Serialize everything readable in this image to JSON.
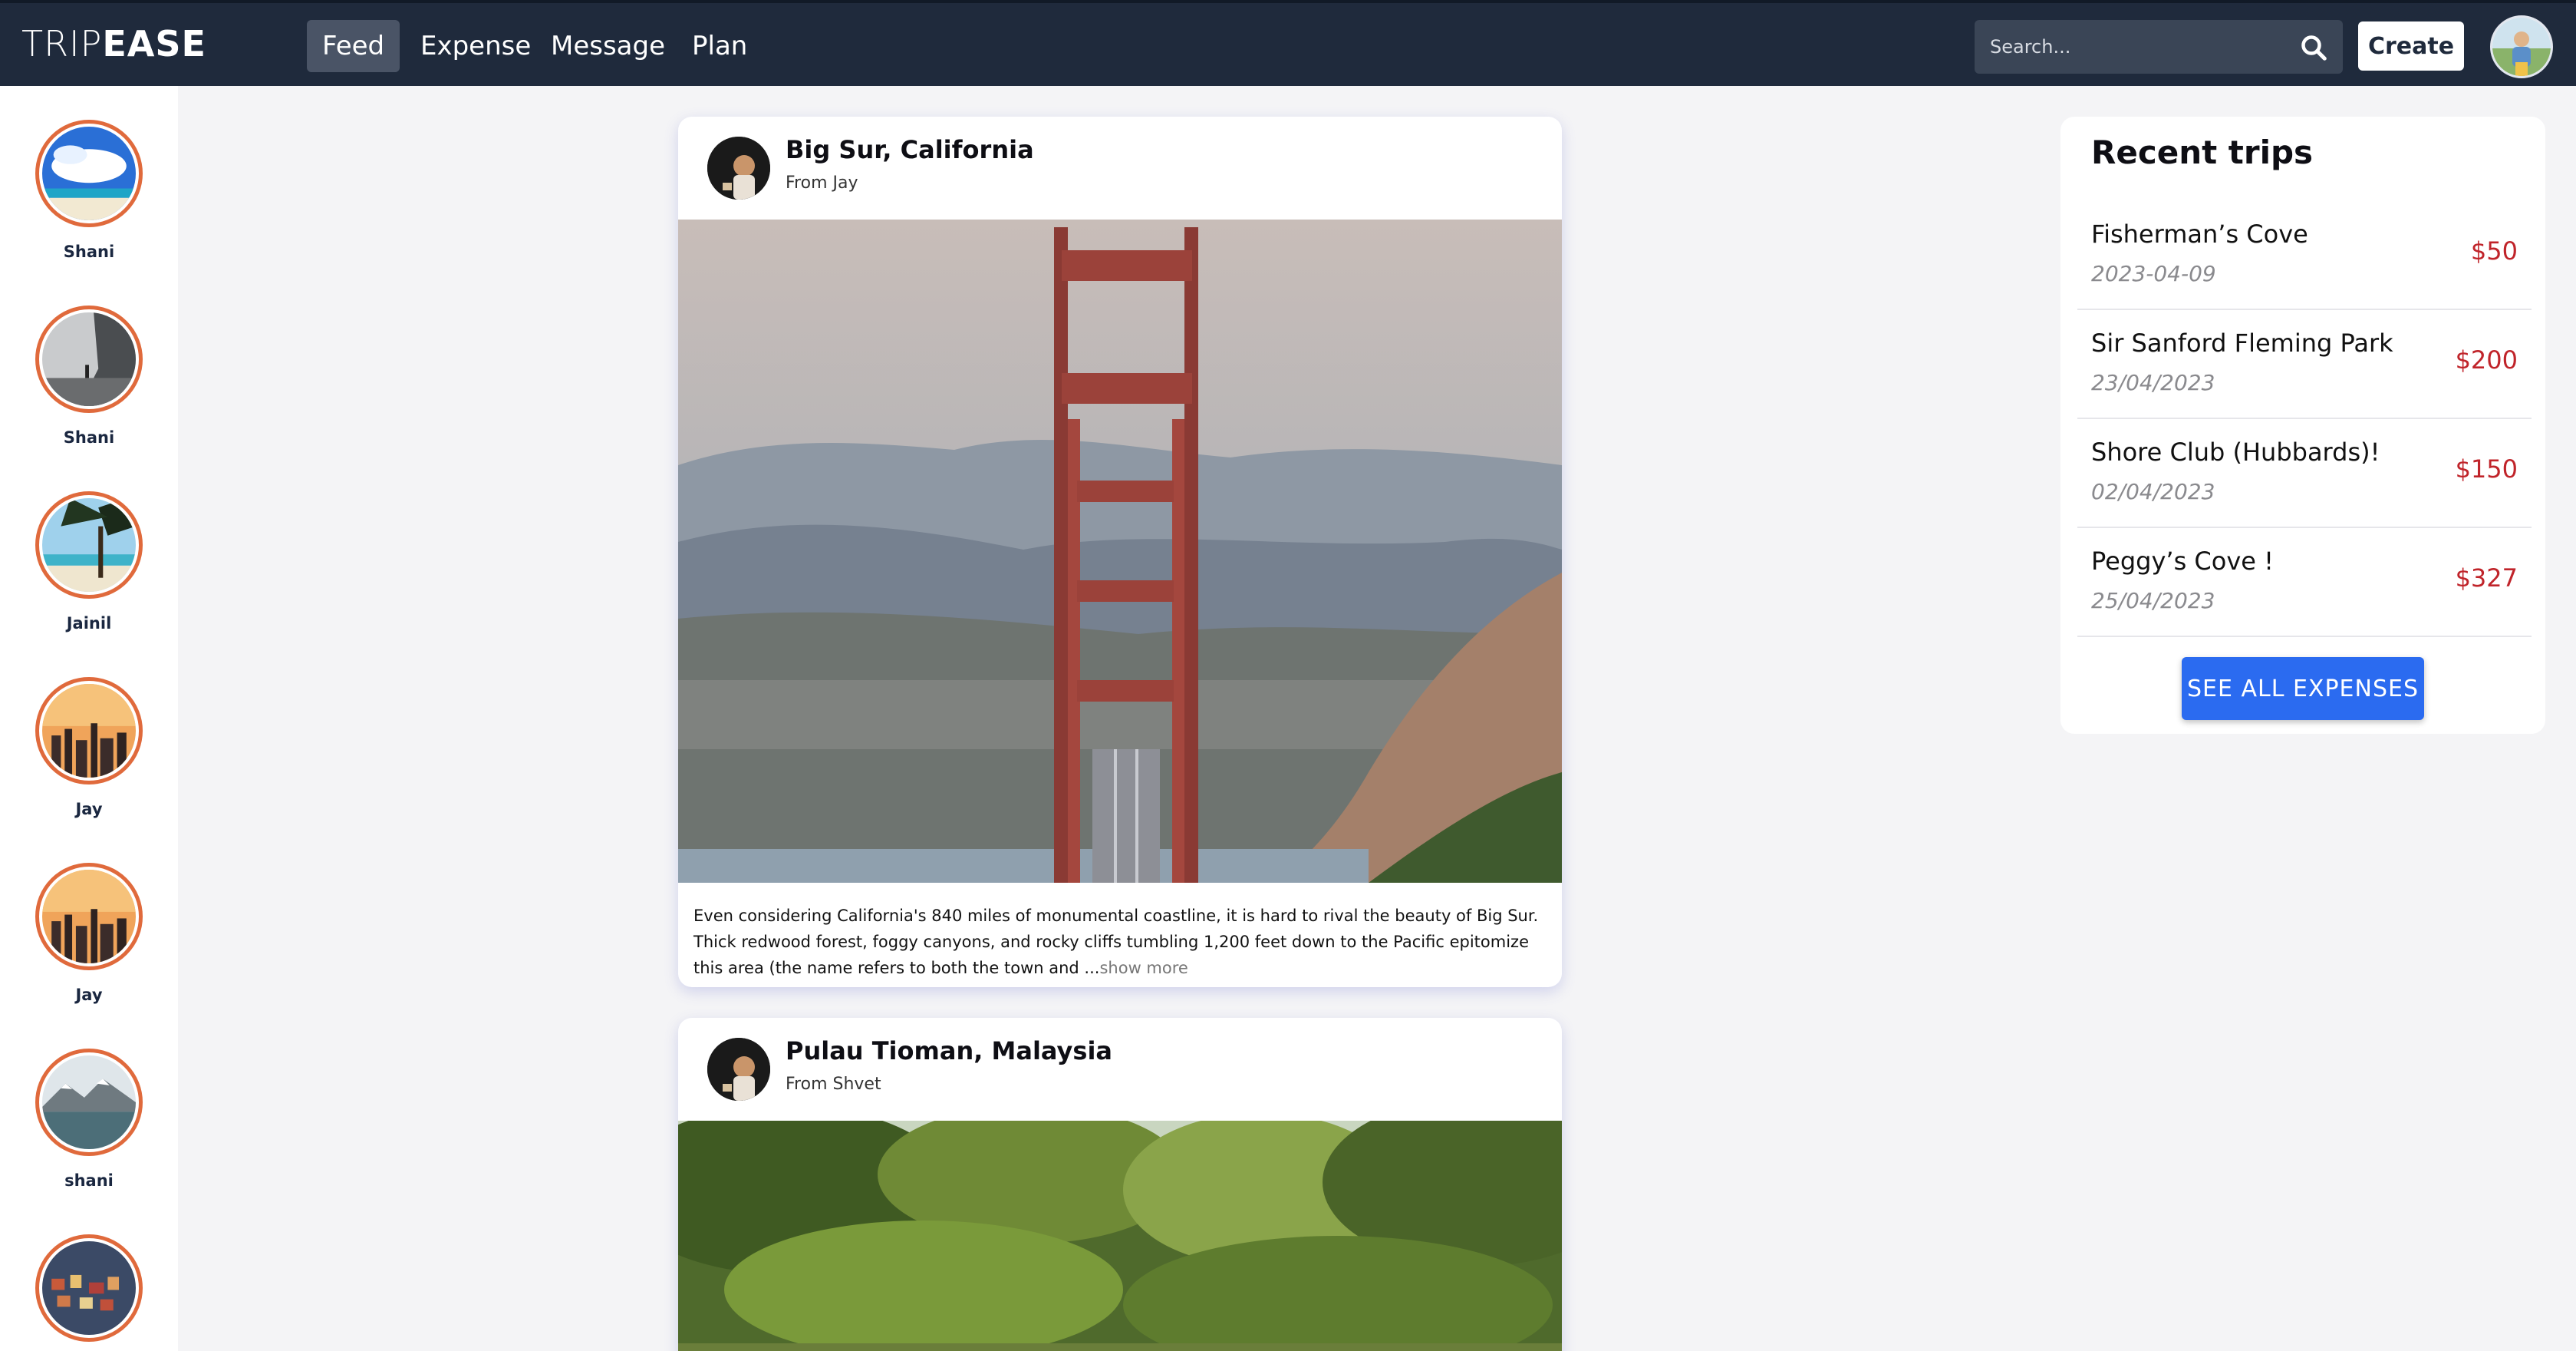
{
  "app": {
    "logo_light": "TRIP",
    "logo_bold": "EASE"
  },
  "nav": {
    "tabs": [
      {
        "label": "Feed",
        "active": true
      },
      {
        "label": "Expense",
        "active": false
      },
      {
        "label": "Message",
        "active": false
      },
      {
        "label": "Plan",
        "active": false
      }
    ],
    "search_placeholder": "Search...",
    "create_label": "Create"
  },
  "stories": [
    {
      "name": "Shani",
      "image": "beach-sky"
    },
    {
      "name": "Shani",
      "image": "misty-cliff"
    },
    {
      "name": "Jainil",
      "image": "palm-beach"
    },
    {
      "name": "Jay",
      "image": "city-sunset"
    },
    {
      "name": "Jay",
      "image": "city-sunset"
    },
    {
      "name": "shani",
      "image": "glacier-lake"
    },
    {
      "name": "",
      "image": "coastal-town"
    }
  ],
  "posts": [
    {
      "title": "Big Sur, California",
      "from": "From Jay",
      "image": "golden-gate-bridge",
      "caption": "Even considering California's 840 miles of monumental coastline, it is hard to rival the beauty of Big Sur. Thick redwood forest, foggy canyons, and rocky cliffs tumbling 1,200 feet down to the Pacific epitomize this area (the name refers to both the town and ...",
      "show_more": "show more"
    },
    {
      "title": "Pulau Tioman, Malaysia",
      "from": "From Shvet",
      "image": "jungle-stream"
    }
  ],
  "recent_trips": {
    "title": "Recent trips",
    "items": [
      {
        "name": "Fisherman’s Cove",
        "date": "2023-04-09",
        "amount": "$50"
      },
      {
        "name": "Sir Sanford Fleming Park",
        "date": "23/04/2023",
        "amount": "$200"
      },
      {
        "name": "Shore Club (Hubbards)!",
        "date": "02/04/2023",
        "amount": "$150"
      },
      {
        "name": "Peggy’s Cove !",
        "date": "25/04/2023",
        "amount": "$327"
      }
    ],
    "see_all_label": "SEE ALL EXPENSES"
  },
  "colors": {
    "navbar": "#1f2a3c",
    "accent_button": "#2b6bf0",
    "amount_red": "#c0242a",
    "story_ring": "#e06a3c"
  }
}
